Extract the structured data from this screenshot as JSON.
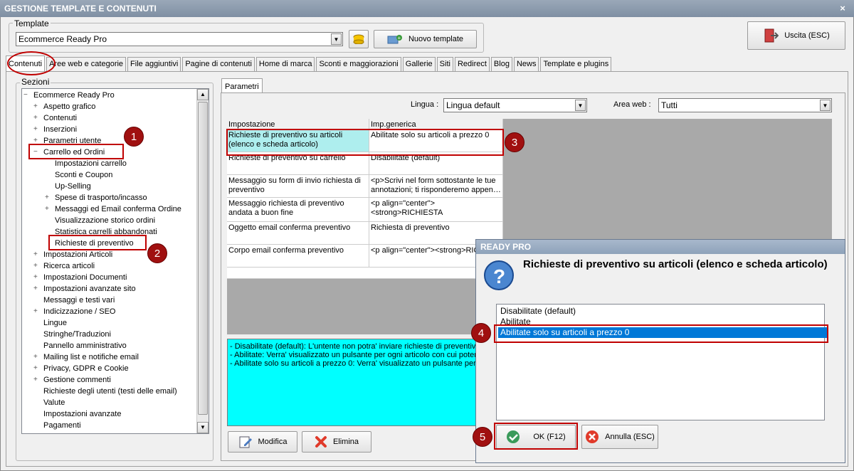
{
  "window": {
    "title": "GESTIONE TEMPLATE E CONTENUTI",
    "close": "×"
  },
  "template": {
    "group_label": "Template",
    "value": "Ecommerce Ready Pro",
    "new_button": "Nuovo template",
    "exit_button": "Uscita (ESC)"
  },
  "tabs": [
    "Contenuti",
    "Aree web e categorie",
    "File aggiuntivi",
    "Pagine di contenuti",
    "Home di marca",
    "Sconti e maggiorazioni",
    "Gallerie",
    "Siti",
    "Redirect",
    "Blog",
    "News",
    "Template e plugins"
  ],
  "sections": {
    "group_label": "Sezioni",
    "root": "Ecommerce Ready Pro",
    "items_top": [
      {
        "label": "Aspetto grafico",
        "exp": "+"
      },
      {
        "label": "Contenuti",
        "exp": "+"
      },
      {
        "label": "Inserzioni",
        "exp": "+"
      },
      {
        "label": "Parametri utente",
        "exp": "+"
      },
      {
        "label": "Carrello ed Ordini",
        "exp": "−"
      }
    ],
    "children": [
      {
        "label": "Impostazioni carrello",
        "exp": ""
      },
      {
        "label": "Sconti e Coupon",
        "exp": ""
      },
      {
        "label": "Up-Selling",
        "exp": ""
      },
      {
        "label": "Spese di trasporto/incasso",
        "exp": "+"
      },
      {
        "label": "Messaggi ed Email conferma Ordine",
        "exp": "+"
      },
      {
        "label": "Visualizzazione storico ordini",
        "exp": ""
      },
      {
        "label": "Statistica carrelli abbandonati",
        "exp": ""
      },
      {
        "label": "Richieste di preventivo",
        "exp": ""
      }
    ],
    "items_bottom": [
      {
        "label": "Impostazioni Articoli",
        "exp": "+"
      },
      {
        "label": "Ricerca articoli",
        "exp": "+"
      },
      {
        "label": "Impostazioni Documenti",
        "exp": "+"
      },
      {
        "label": "Impostazioni avanzate sito",
        "exp": "+"
      },
      {
        "label": "Messaggi e testi vari",
        "exp": ""
      },
      {
        "label": "Indicizzazione / SEO",
        "exp": "+"
      },
      {
        "label": "Lingue",
        "exp": ""
      },
      {
        "label": "Stringhe/Traduzioni",
        "exp": ""
      },
      {
        "label": "Pannello amministrativo",
        "exp": ""
      },
      {
        "label": "Mailing list e notifiche email",
        "exp": "+"
      },
      {
        "label": "Privacy, GDPR e Cookie",
        "exp": "+"
      },
      {
        "label": "Gestione commenti",
        "exp": "+"
      },
      {
        "label": "Richieste degli utenti (testi delle email)",
        "exp": ""
      },
      {
        "label": "Valute",
        "exp": ""
      },
      {
        "label": "Impostazioni avanzate",
        "exp": ""
      },
      {
        "label": "Pagamenti",
        "exp": ""
      }
    ]
  },
  "params": {
    "tab": "Parametri",
    "lingua_label": "Lingua :",
    "lingua_value": "Lingua default",
    "area_label": "Area web :",
    "area_value": "Tutti",
    "col_setting": "Impostazione",
    "col_value": "Imp.generica",
    "rows": [
      {
        "setting": "Richieste di preventivo su articoli (elenco e scheda articolo)",
        "value": "Abilitate solo su articoli a prezzo 0"
      },
      {
        "setting": "Richieste di preventivo su carrello",
        "value": "Disabilitate (default)"
      },
      {
        "setting": "Messaggio su form di invio richiesta di preventivo",
        "value": "<p>Scrivi nel form sottostante le tue annotazioni; ti risponderemo appen…"
      },
      {
        "setting": "Messaggio richiesta di preventivo andata a buon fine",
        "value": "<p align=\"center\"><strong>RICHIESTA"
      },
      {
        "setting": "Oggetto email conferma preventivo",
        "value": "Richiesta di preventivo"
      },
      {
        "setting": "Corpo email conferma preventivo",
        "value": "<p align=\"center\"><strong>RICH"
      }
    ],
    "info": [
      "- Disabilitate (default): L'untente non potra' inviare richieste di preventiv",
      "- Abilitate: Verra' visualizzato un pulsante per ogni articolo con cui poter",
      "- Abilitate solo su articoli a prezzo 0: Verra' visualizzato un pulsante per r"
    ],
    "edit_button": "Modifica",
    "delete_button": "Elimina"
  },
  "dialog": {
    "title": "READY PRO",
    "question": "Richieste di preventivo su articoli (elenco e scheda articolo)",
    "options": [
      "Disabilitate (default)",
      "Abilitate",
      "Abilitate solo su articoli a prezzo 0"
    ],
    "selected_index": 2,
    "ok_button": "OK (F12)",
    "cancel_button": "Annulla (ESC)"
  },
  "badges": [
    "1",
    "2",
    "3",
    "4",
    "5"
  ],
  "colors": {
    "accent_red": "#c00000",
    "info_bg": "#00ffff",
    "selection": "#0078d7",
    "selected_cell": "#aeeeee"
  }
}
